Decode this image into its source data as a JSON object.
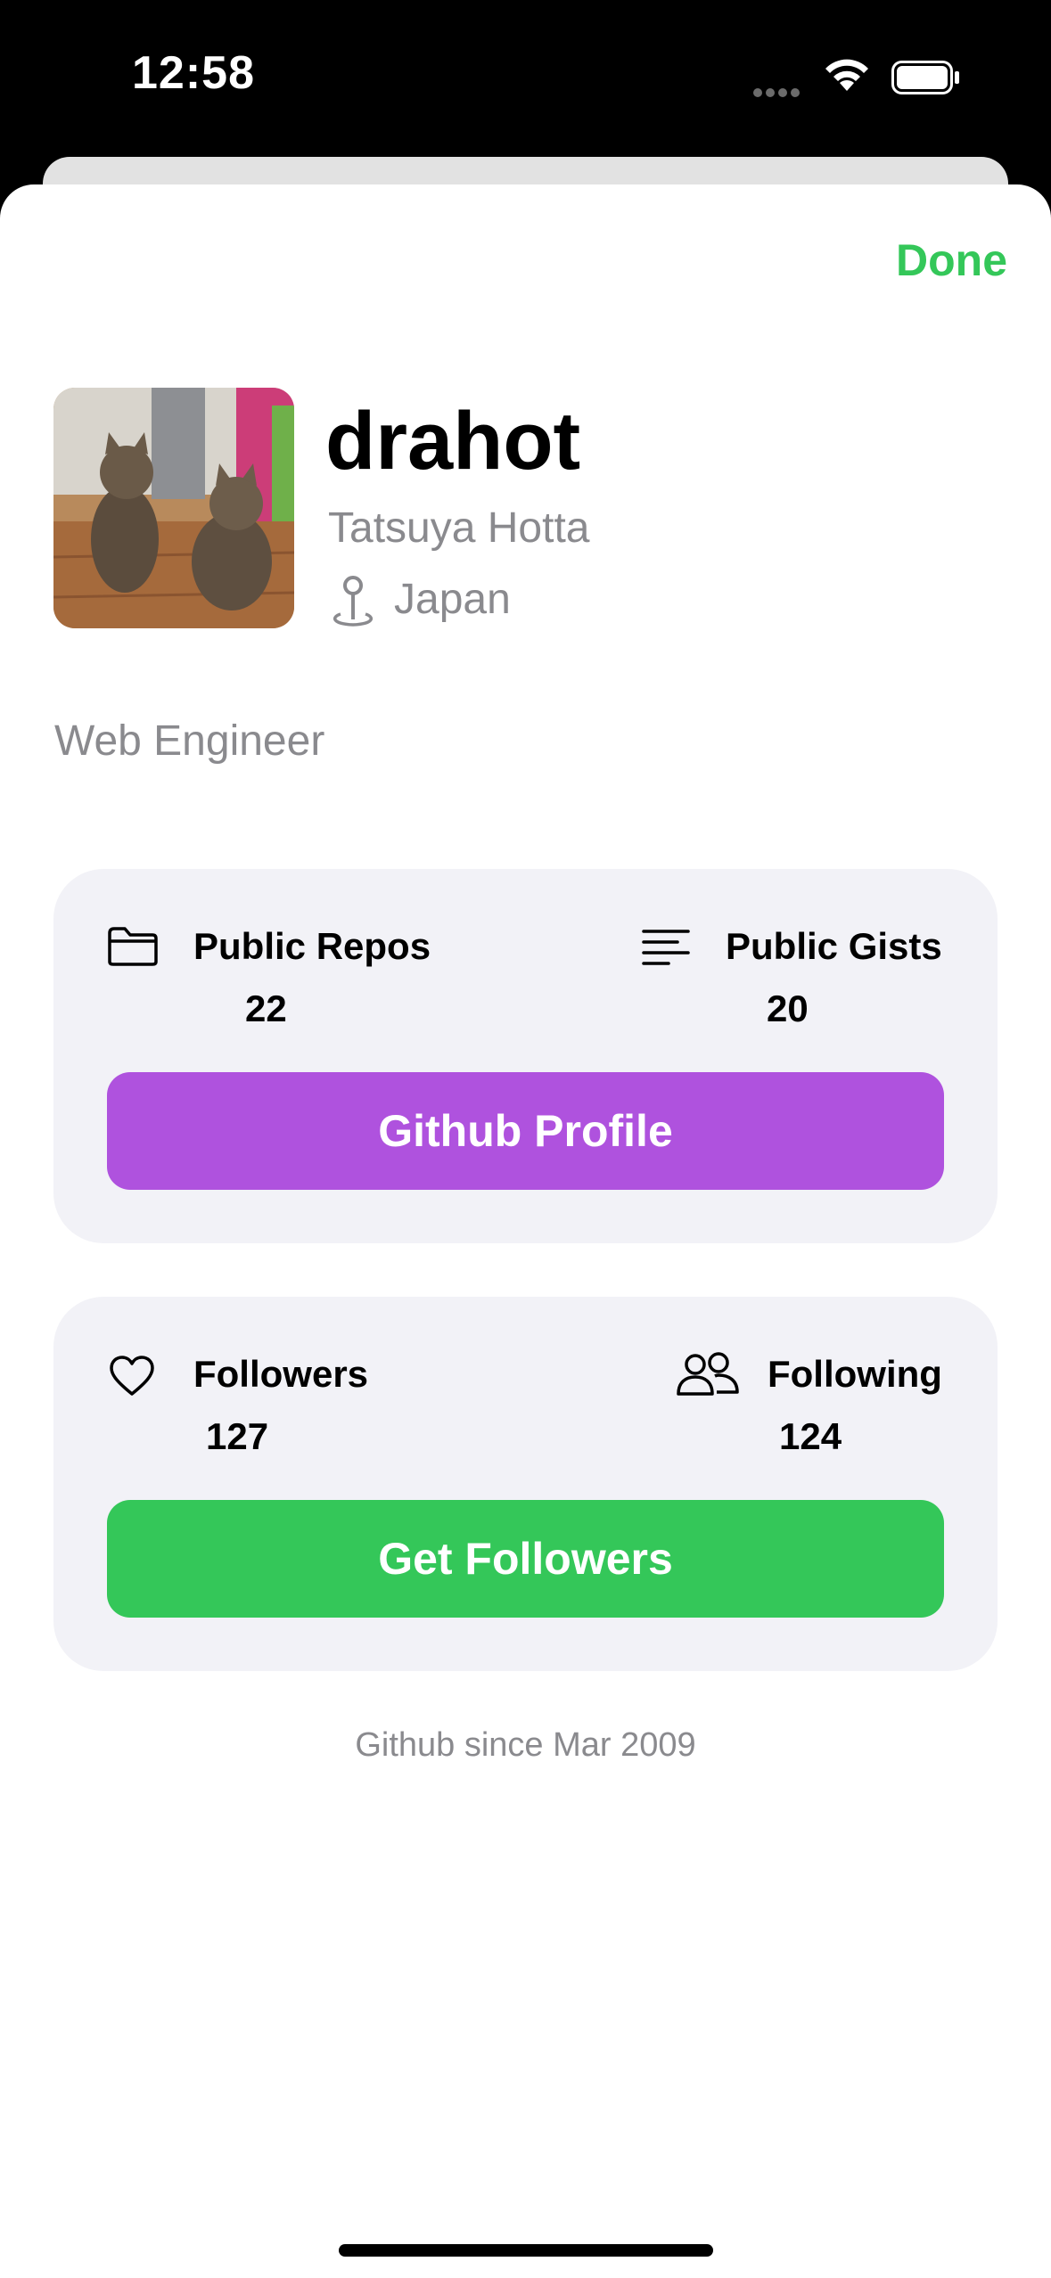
{
  "status_bar": {
    "time": "12:58"
  },
  "header": {
    "done_label": "Done"
  },
  "profile": {
    "username": "drahot",
    "full_name": "Tatsuya Hotta",
    "location": "Japan",
    "bio": "Web Engineer",
    "avatar_icon": "avatar-photo"
  },
  "repo_card": {
    "left": {
      "icon": "folder-icon",
      "label": "Public Repos",
      "value": "22"
    },
    "right": {
      "icon": "text-lines-icon",
      "label": "Public Gists",
      "value": "20"
    },
    "button_label": "Github Profile",
    "button_color": "#af52de"
  },
  "follow_card": {
    "left": {
      "icon": "heart-icon",
      "label": "Followers",
      "value": "127"
    },
    "right": {
      "icon": "people-icon",
      "label": "Following",
      "value": "124"
    },
    "button_label": "Get Followers",
    "button_color": "#34c759"
  },
  "footer": {
    "since": "Github since Mar 2009"
  },
  "colors": {
    "accent": "#34c759",
    "secondary_text": "#8a8a8e",
    "card_bg": "#f2f2f7"
  }
}
